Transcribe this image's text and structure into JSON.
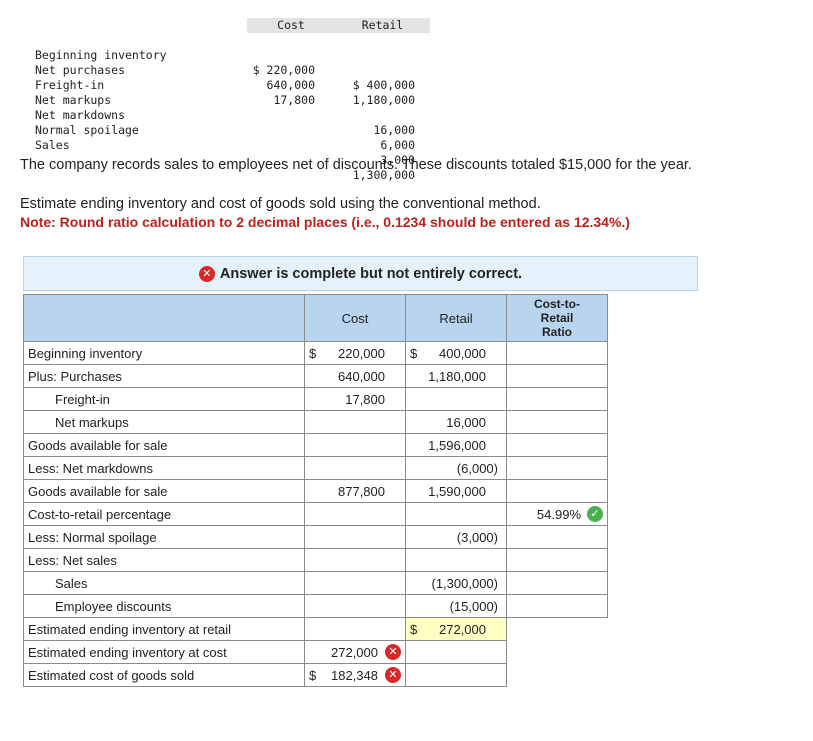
{
  "given": {
    "header_cost": "Cost",
    "header_retail": "Retail",
    "rows": [
      {
        "label": "Beginning inventory",
        "cost": "$ 220,000",
        "retail": "$ 400,000"
      },
      {
        "label": "Net purchases",
        "cost": "640,000",
        "retail": "1,180,000"
      },
      {
        "label": "Freight-in",
        "cost": "17,800",
        "retail": ""
      },
      {
        "label": "Net markups",
        "cost": "",
        "retail": "16,000"
      },
      {
        "label": "Net markdowns",
        "cost": "",
        "retail": "6,000"
      },
      {
        "label": "Normal spoilage",
        "cost": "",
        "retail": "3,000"
      },
      {
        "label": "Sales",
        "cost": "",
        "retail": "1,300,000"
      }
    ]
  },
  "prose": {
    "line1": "The company records sales to employees net of discounts. These discounts totaled $15,000 for the year.",
    "line2": "Estimate ending inventory and cost of goods sold using the conventional method.",
    "note": "Note: Round ratio calculation to 2 decimal places (i.e., 0.1234 should be entered as 12.34%.)"
  },
  "banner": {
    "text": "Answer is complete but not entirely correct."
  },
  "table": {
    "headers": {
      "cost": "Cost",
      "retail": "Retail",
      "ratio": "Cost-to-\nRetail\nRatio"
    },
    "rows": [
      {
        "label": "Beginning inventory",
        "cost_dollar": "$",
        "cost": "220,000",
        "retail_dollar": "$",
        "retail": "400,000",
        "ratio": ""
      },
      {
        "label": "Plus: Purchases",
        "cost_dollar": "",
        "cost": "640,000",
        "retail_dollar": "",
        "retail": "1,180,000",
        "ratio": ""
      },
      {
        "label": "Freight-in",
        "cost_dollar": "",
        "cost": "17,800",
        "retail_dollar": "",
        "retail": "",
        "ratio": ""
      },
      {
        "label": "Net markups",
        "cost_dollar": "",
        "cost": "",
        "retail_dollar": "",
        "retail": "16,000",
        "ratio": ""
      },
      {
        "label": "Goods available for sale",
        "cost_dollar": "",
        "cost": "",
        "retail_dollar": "",
        "retail": "1,596,000",
        "ratio": ""
      },
      {
        "label": "Less: Net markdowns",
        "cost_dollar": "",
        "cost": "",
        "retail_dollar": "",
        "retail": "(6,000)",
        "ratio": ""
      },
      {
        "label": "Goods available for sale",
        "cost_dollar": "",
        "cost": "877,800",
        "retail_dollar": "",
        "retail": "1,590,000",
        "ratio": ""
      },
      {
        "label": "Cost-to-retail percentage",
        "cost_dollar": "",
        "cost": "",
        "retail_dollar": "",
        "retail": "",
        "ratio": "54.99%"
      },
      {
        "label": "Less: Normal spoilage",
        "cost_dollar": "",
        "cost": "",
        "retail_dollar": "",
        "retail": "(3,000)",
        "ratio": ""
      },
      {
        "label": "Less: Net sales",
        "cost_dollar": "",
        "cost": "",
        "retail_dollar": "",
        "retail": "",
        "ratio": ""
      },
      {
        "label": "Sales",
        "cost_dollar": "",
        "cost": "",
        "retail_dollar": "",
        "retail": "(1,300,000)",
        "ratio": ""
      },
      {
        "label": "Employee discounts",
        "cost_dollar": "",
        "cost": "",
        "retail_dollar": "",
        "retail": "(15,000)",
        "ratio": ""
      },
      {
        "label": "Estimated ending inventory at retail",
        "cost_dollar": "",
        "cost": "",
        "retail_dollar": "$",
        "retail": "272,000",
        "ratio": ""
      },
      {
        "label": "Estimated ending inventory at cost",
        "cost_dollar": "",
        "cost": "272,000",
        "retail_dollar": "",
        "retail": "",
        "ratio": ""
      },
      {
        "label": "Estimated cost of goods sold",
        "cost_dollar": "$",
        "cost": "182,348",
        "retail_dollar": "",
        "retail": "",
        "ratio": ""
      }
    ]
  },
  "colors": {
    "incorrect": "#d82828",
    "correct": "#4caf50",
    "header_bg": "#b9d4ee",
    "note_red": "#c0201c"
  },
  "icons": {
    "incorrect": "x-circle-icon",
    "correct": "check-circle-icon"
  }
}
